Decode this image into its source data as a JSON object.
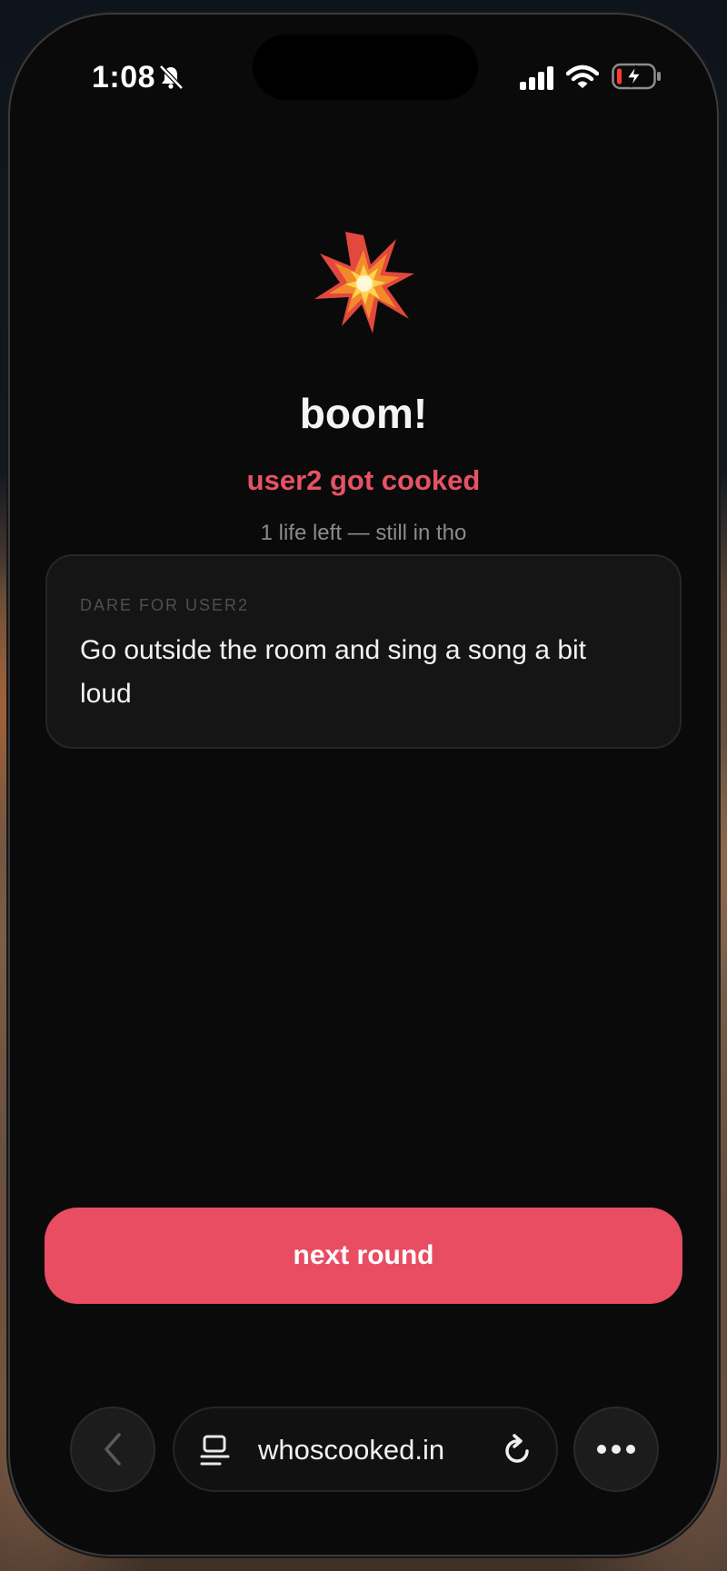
{
  "status_bar": {
    "time": "1:08"
  },
  "result": {
    "icon": "collision-emoji",
    "title": "boom!",
    "subtitle": "user2 got cooked",
    "lives_text": "1 life left — still in tho"
  },
  "dare": {
    "label": "DARE FOR USER2",
    "text": "Go outside the room and sing a song a bit loud"
  },
  "actions": {
    "next_round_label": "next round"
  },
  "browser": {
    "url": "whoscooked.in"
  },
  "colors": {
    "accent": "#e94d62",
    "background": "#0a0a0a",
    "card": "#151515"
  }
}
